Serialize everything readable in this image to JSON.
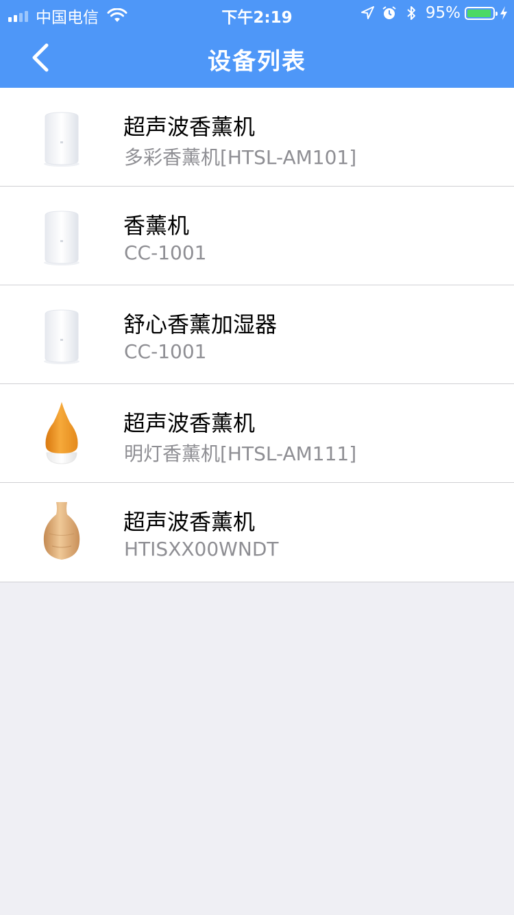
{
  "status_bar": {
    "carrier": "中国电信",
    "time": "下午2:19",
    "battery_percent": "95%",
    "battery_level": 0.95,
    "signal_bars": 2
  },
  "nav": {
    "title": "设备列表",
    "back_icon": "chevron-left-icon"
  },
  "devices": [
    {
      "name": "超声波香薰机",
      "model": "多彩香薰机[HTSL-AM101]",
      "image": "white-cylinder-diffuser"
    },
    {
      "name": "香薰机",
      "model": "CC-1001",
      "image": "white-cylinder-diffuser"
    },
    {
      "name": "舒心香薰加湿器",
      "model": "CC-1001",
      "image": "white-cylinder-diffuser"
    },
    {
      "name": "超声波香薰机",
      "model": "明灯香薰机[HTSL-AM111]",
      "image": "orange-drop-diffuser"
    },
    {
      "name": "超声波香薰机",
      "model": "HTISXX00WNDT",
      "image": "wood-vase-diffuser"
    }
  ],
  "colors": {
    "header_blue": "#4e97f8",
    "background": "#efeff4",
    "battery_green": "#4cd964"
  }
}
